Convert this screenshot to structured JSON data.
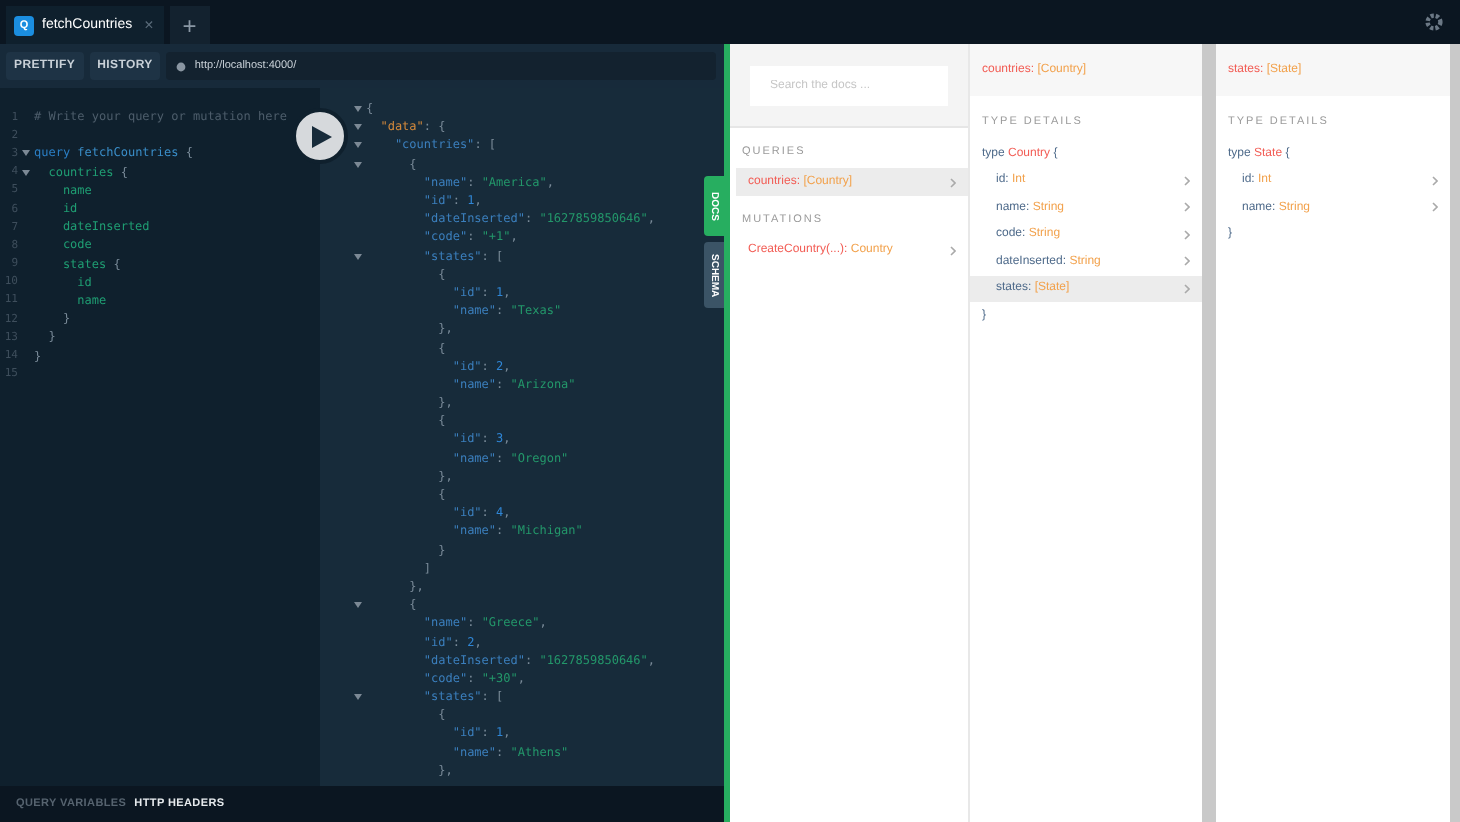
{
  "tabs": [
    {
      "logo": "Q",
      "title": "fetchCountries",
      "close": "×",
      "selected": true
    }
  ],
  "new_tab": "+",
  "toolbar": {
    "buttons": [
      "PRETTIFY",
      "HISTORY"
    ],
    "url": "http://localhost:4000/"
  },
  "editor": {
    "lines": [
      {
        "number": "1",
        "foldable": false,
        "tokens": [
          {
            "kind": "comment",
            "text": "# Write your query or mutation here"
          }
        ]
      },
      {
        "number": "2",
        "foldable": false
      },
      {
        "number": "3",
        "foldable": true,
        "tokens": [
          {
            "kind": "keyword",
            "text": "query"
          },
          {
            "kind": "def",
            "text": " fetchCountries"
          },
          {
            "kind": "punct",
            "text": " {"
          }
        ]
      },
      {
        "number": "4",
        "foldable": true,
        "tokens": [
          {
            "kind": "field",
            "text": "  countries"
          },
          {
            "kind": "punct",
            "text": " {"
          }
        ]
      },
      {
        "number": "5",
        "foldable": false,
        "tokens": [
          {
            "kind": "field",
            "text": "    name"
          }
        ]
      },
      {
        "number": "6",
        "foldable": false,
        "tokens": [
          {
            "kind": "field",
            "text": "    id"
          }
        ]
      },
      {
        "number": "7",
        "foldable": false,
        "tokens": [
          {
            "kind": "field",
            "text": "    dateInserted"
          }
        ]
      },
      {
        "number": "8",
        "foldable": false,
        "tokens": [
          {
            "kind": "field",
            "text": "    code"
          }
        ]
      },
      {
        "number": "9",
        "foldable": false,
        "tokens": [
          {
            "kind": "field",
            "text": "    states"
          },
          {
            "kind": "punct",
            "text": " {"
          }
        ]
      },
      {
        "number": "10",
        "foldable": false,
        "tokens": [
          {
            "kind": "field",
            "text": "      id"
          }
        ]
      },
      {
        "number": "11",
        "foldable": false,
        "tokens": [
          {
            "kind": "field",
            "text": "      name"
          }
        ]
      },
      {
        "number": "12",
        "foldable": false,
        "tokens": [
          {
            "kind": "punct",
            "text": "    }"
          }
        ]
      },
      {
        "number": "13",
        "foldable": false,
        "tokens": [
          {
            "kind": "punct",
            "text": "  }"
          }
        ]
      },
      {
        "number": "14",
        "foldable": false,
        "tokens": [
          {
            "kind": "punct",
            "text": "}"
          }
        ]
      },
      {
        "number": "15",
        "foldable": false
      }
    ]
  },
  "results": {
    "lines": [
      {
        "foldable": true,
        "tokens": [
          {
            "kind": "punct",
            "text": "{"
          }
        ]
      },
      {
        "foldable": true,
        "tokens": [
          {
            "kind": "datakey",
            "text": "  \"data\""
          },
          {
            "kind": "punct",
            "text": ": {"
          }
        ]
      },
      {
        "foldable": true,
        "tokens": [
          {
            "kind": "key",
            "text": "    \"countries\""
          },
          {
            "kind": "punct",
            "text": ": ["
          }
        ]
      },
      {
        "foldable": true,
        "tokens": [
          {
            "kind": "punct",
            "text": "      {"
          }
        ]
      },
      {
        "foldable": false,
        "tokens": [
          {
            "kind": "key",
            "text": "        \"name\""
          },
          {
            "kind": "punct",
            "text": ": "
          },
          {
            "kind": "string",
            "text": "\"America\""
          },
          {
            "kind": "punct",
            "text": ","
          }
        ]
      },
      {
        "foldable": false,
        "tokens": [
          {
            "kind": "key",
            "text": "        \"id\""
          },
          {
            "kind": "punct",
            "text": ": "
          },
          {
            "kind": "number",
            "text": "1"
          },
          {
            "kind": "punct",
            "text": ","
          }
        ]
      },
      {
        "foldable": false,
        "tokens": [
          {
            "kind": "key",
            "text": "        \"dateInserted\""
          },
          {
            "kind": "punct",
            "text": ": "
          },
          {
            "kind": "string",
            "text": "\"1627859850646\""
          },
          {
            "kind": "punct",
            "text": ","
          }
        ]
      },
      {
        "foldable": false,
        "tokens": [
          {
            "kind": "key",
            "text": "        \"code\""
          },
          {
            "kind": "punct",
            "text": ": "
          },
          {
            "kind": "string",
            "text": "\"+1\""
          },
          {
            "kind": "punct",
            "text": ","
          }
        ]
      },
      {
        "foldable": true,
        "tokens": [
          {
            "kind": "key",
            "text": "        \"states\""
          },
          {
            "kind": "punct",
            "text": ": ["
          }
        ]
      },
      {
        "foldable": false,
        "tokens": [
          {
            "kind": "punct",
            "text": "          {"
          }
        ]
      },
      {
        "foldable": false,
        "tokens": [
          {
            "kind": "key",
            "text": "            \"id\""
          },
          {
            "kind": "punct",
            "text": ": "
          },
          {
            "kind": "number",
            "text": "1"
          },
          {
            "kind": "punct",
            "text": ","
          }
        ]
      },
      {
        "foldable": false,
        "tokens": [
          {
            "kind": "key",
            "text": "            \"name\""
          },
          {
            "kind": "punct",
            "text": ": "
          },
          {
            "kind": "string",
            "text": "\"Texas\""
          }
        ]
      },
      {
        "foldable": false,
        "tokens": [
          {
            "kind": "punct",
            "text": "          },"
          }
        ]
      },
      {
        "foldable": false,
        "tokens": [
          {
            "kind": "punct",
            "text": "          {"
          }
        ]
      },
      {
        "foldable": false,
        "tokens": [
          {
            "kind": "key",
            "text": "            \"id\""
          },
          {
            "kind": "punct",
            "text": ": "
          },
          {
            "kind": "number",
            "text": "2"
          },
          {
            "kind": "punct",
            "text": ","
          }
        ]
      },
      {
        "foldable": false,
        "tokens": [
          {
            "kind": "key",
            "text": "            \"name\""
          },
          {
            "kind": "punct",
            "text": ": "
          },
          {
            "kind": "string",
            "text": "\"Arizona\""
          }
        ]
      },
      {
        "foldable": false,
        "tokens": [
          {
            "kind": "punct",
            "text": "          },"
          }
        ]
      },
      {
        "foldable": false,
        "tokens": [
          {
            "kind": "punct",
            "text": "          {"
          }
        ]
      },
      {
        "foldable": false,
        "tokens": [
          {
            "kind": "key",
            "text": "            \"id\""
          },
          {
            "kind": "punct",
            "text": ": "
          },
          {
            "kind": "number",
            "text": "3"
          },
          {
            "kind": "punct",
            "text": ","
          }
        ]
      },
      {
        "foldable": false,
        "tokens": [
          {
            "kind": "key",
            "text": "            \"name\""
          },
          {
            "kind": "punct",
            "text": ": "
          },
          {
            "kind": "string",
            "text": "\"Oregon\""
          }
        ]
      },
      {
        "foldable": false,
        "tokens": [
          {
            "kind": "punct",
            "text": "          },"
          }
        ]
      },
      {
        "foldable": false,
        "tokens": [
          {
            "kind": "punct",
            "text": "          {"
          }
        ]
      },
      {
        "foldable": false,
        "tokens": [
          {
            "kind": "key",
            "text": "            \"id\""
          },
          {
            "kind": "punct",
            "text": ": "
          },
          {
            "kind": "number",
            "text": "4"
          },
          {
            "kind": "punct",
            "text": ","
          }
        ]
      },
      {
        "foldable": false,
        "tokens": [
          {
            "kind": "key",
            "text": "            \"name\""
          },
          {
            "kind": "punct",
            "text": ": "
          },
          {
            "kind": "string",
            "text": "\"Michigan\""
          }
        ]
      },
      {
        "foldable": false,
        "tokens": [
          {
            "kind": "punct",
            "text": "          }"
          }
        ]
      },
      {
        "foldable": false,
        "tokens": [
          {
            "kind": "punct",
            "text": "        ]"
          }
        ]
      },
      {
        "foldable": false,
        "tokens": [
          {
            "kind": "punct",
            "text": "      },"
          }
        ]
      },
      {
        "foldable": true,
        "tokens": [
          {
            "kind": "punct",
            "text": "      {"
          }
        ]
      },
      {
        "foldable": false,
        "tokens": [
          {
            "kind": "key",
            "text": "        \"name\""
          },
          {
            "kind": "punct",
            "text": ": "
          },
          {
            "kind": "string",
            "text": "\"Greece\""
          },
          {
            "kind": "punct",
            "text": ","
          }
        ]
      },
      {
        "foldable": false,
        "tokens": [
          {
            "kind": "key",
            "text": "        \"id\""
          },
          {
            "kind": "punct",
            "text": ": "
          },
          {
            "kind": "number",
            "text": "2"
          },
          {
            "kind": "punct",
            "text": ","
          }
        ]
      },
      {
        "foldable": false,
        "tokens": [
          {
            "kind": "key",
            "text": "        \"dateInserted\""
          },
          {
            "kind": "punct",
            "text": ": "
          },
          {
            "kind": "string",
            "text": "\"1627859850646\""
          },
          {
            "kind": "punct",
            "text": ","
          }
        ]
      },
      {
        "foldable": false,
        "tokens": [
          {
            "kind": "key",
            "text": "        \"code\""
          },
          {
            "kind": "punct",
            "text": ": "
          },
          {
            "kind": "string",
            "text": "\"+30\""
          },
          {
            "kind": "punct",
            "text": ","
          }
        ]
      },
      {
        "foldable": true,
        "tokens": [
          {
            "kind": "key",
            "text": "        \"states\""
          },
          {
            "kind": "punct",
            "text": ": ["
          }
        ]
      },
      {
        "foldable": false,
        "tokens": [
          {
            "kind": "punct",
            "text": "          {"
          }
        ]
      },
      {
        "foldable": false,
        "tokens": [
          {
            "kind": "key",
            "text": "            \"id\""
          },
          {
            "kind": "punct",
            "text": ": "
          },
          {
            "kind": "number",
            "text": "1"
          },
          {
            "kind": "punct",
            "text": ","
          }
        ]
      },
      {
        "foldable": false,
        "tokens": [
          {
            "kind": "key",
            "text": "            \"name\""
          },
          {
            "kind": "punct",
            "text": ": "
          },
          {
            "kind": "string",
            "text": "\"Athens\""
          }
        ]
      },
      {
        "foldable": false,
        "tokens": [
          {
            "kind": "punct",
            "text": "          },"
          }
        ]
      }
    ]
  },
  "side_tabs": [
    {
      "label": "DOCS",
      "selected": true
    },
    {
      "label": "SCHEMA",
      "selected": false
    }
  ],
  "docs": {
    "search": {
      "placeholder": "Search the docs ..."
    },
    "sections": [
      {
        "title": "QUERIES",
        "items": [
          {
            "name": "countries:",
            "type": "[Country]",
            "selected": true
          }
        ]
      },
      {
        "title": "MUTATIONS",
        "items": [
          {
            "name": "CreateCountry(...):",
            "type": "Country",
            "selected": false
          }
        ]
      }
    ],
    "columns": [
      {
        "title_name": "countries:",
        "title_type": "[Country]",
        "heading": "TYPE DETAILS",
        "keyword": "type",
        "type_name": "Country",
        "open": "{",
        "close": "}",
        "fields": [
          {
            "name": "id:",
            "type": "Int",
            "selected": false
          },
          {
            "name": "name:",
            "type": "String",
            "selected": false
          },
          {
            "name": "code:",
            "type": "String",
            "selected": false
          },
          {
            "name": "dateInserted:",
            "type": "String",
            "selected": false
          },
          {
            "name": "states:",
            "type": "[State]",
            "selected": true
          }
        ]
      },
      {
        "title_name": "states:",
        "title_type": "[State]",
        "heading": "TYPE DETAILS",
        "keyword": "type",
        "type_name": "State",
        "open": "{",
        "close": "}",
        "fields": [
          {
            "name": "id:",
            "type": "Int",
            "selected": false
          },
          {
            "name": "name:",
            "type": "String",
            "selected": false
          }
        ]
      }
    ]
  },
  "bottom_tabs": [
    {
      "label": "QUERY VARIABLES",
      "selected": false
    },
    {
      "label": "HTTP HEADERS",
      "selected": true
    }
  ]
}
